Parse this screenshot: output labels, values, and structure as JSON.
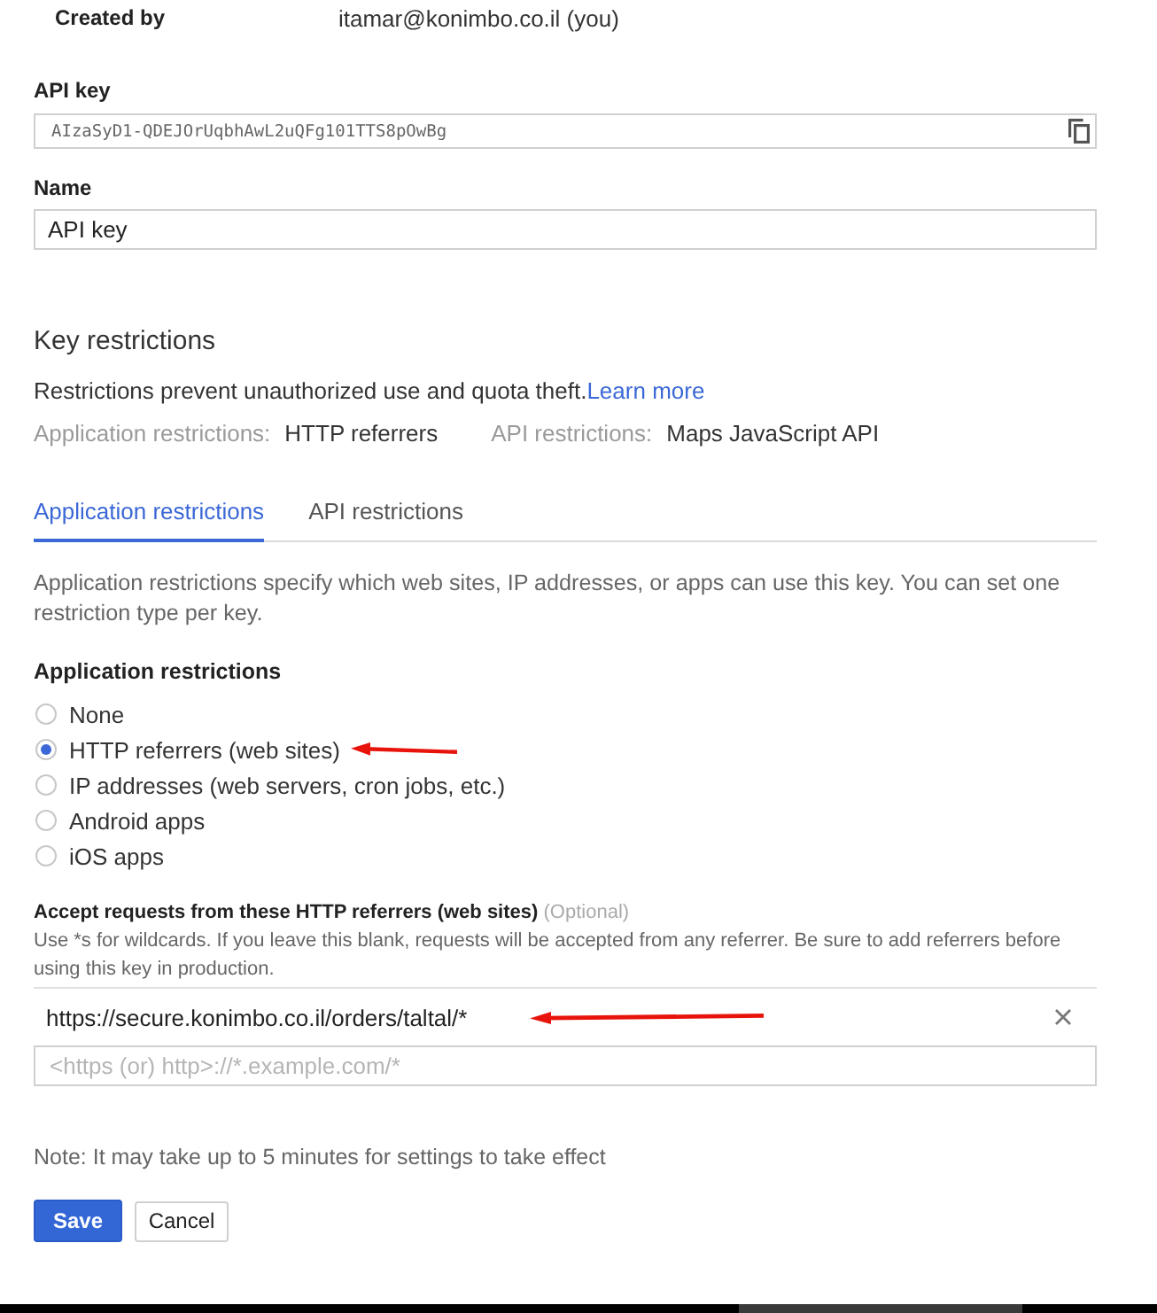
{
  "created_by": {
    "label": "Created by",
    "value": "itamar@konimbo.co.il (you)"
  },
  "api_key": {
    "label": "API key",
    "value": "AIzaSyD1-QDEJOrUqbhAwL2uQFg101TTS8pOwBg"
  },
  "name": {
    "label": "Name",
    "value": "API key"
  },
  "key_restrictions": {
    "title": "Key restrictions",
    "description": "Restrictions prevent unauthorized use and quota theft.",
    "link": "Learn more",
    "summary": [
      {
        "label": "Application restrictions:",
        "value": "HTTP referrers"
      },
      {
        "label": "API restrictions:",
        "value": "Maps JavaScript API"
      }
    ]
  },
  "tabs": [
    {
      "label": "Application restrictions",
      "selected": true
    },
    {
      "label": "API restrictions",
      "selected": false
    }
  ],
  "tab_description": "Application restrictions specify which web sites, IP addresses, or apps can use this key. You can set one restriction type per key.",
  "application_restrictions": {
    "title": "Application restrictions",
    "options": [
      {
        "label": "None",
        "selected": false,
        "arrow_annotation": false
      },
      {
        "label": "HTTP referrers (web sites)",
        "selected": true,
        "arrow_annotation": true
      },
      {
        "label": "IP addresses (web servers, cron jobs, etc.)",
        "selected": false,
        "arrow_annotation": false
      },
      {
        "label": "Android apps",
        "selected": false,
        "arrow_annotation": false
      },
      {
        "label": "iOS apps",
        "selected": false,
        "arrow_annotation": false
      }
    ]
  },
  "referrers": {
    "title": "Accept requests from these HTTP referrers (web sites)",
    "optional": "(Optional)",
    "help": "Use *s for wildcards. If you leave this blank, requests will be accepted from any referrer. Be sure to add referrers before using this key in production.",
    "items": [
      {
        "value": "https://secure.konimbo.co.il/orders/taltal/*",
        "arrow_annotation": true
      }
    ],
    "placeholder": "<https (or) http>://*.example.com/*"
  },
  "note": "Note: It may take up to 5 minutes for settings to take effect",
  "buttons": [
    {
      "label": "Save",
      "kind": "primary"
    },
    {
      "label": "Cancel",
      "kind": "secondary"
    }
  ]
}
